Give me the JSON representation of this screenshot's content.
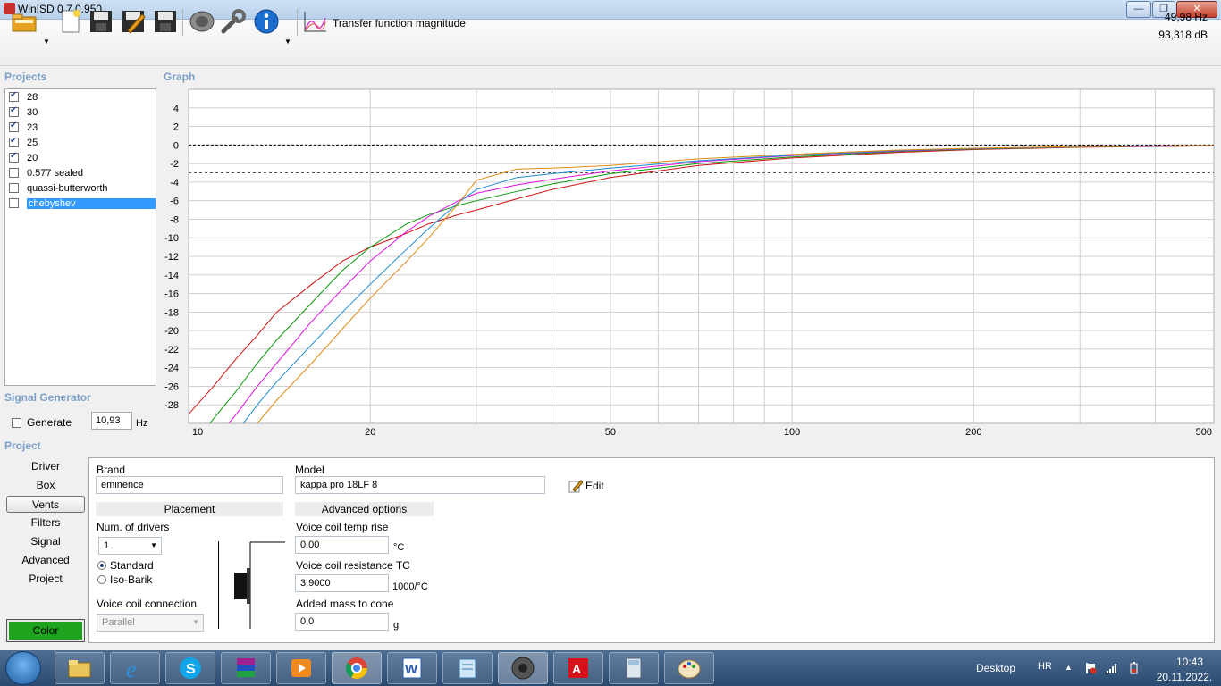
{
  "window": {
    "title": "WinISD 0.7.0.950"
  },
  "toolbar": {
    "mode_label": "Transfer function magnitude",
    "readout_freq": "49,98 Hz",
    "readout_level": "93,318 dB"
  },
  "sections": {
    "projects": "Projects",
    "graph": "Graph",
    "signal_generator": "Signal Generator",
    "project": "Project"
  },
  "projects": [
    {
      "name": "28",
      "checked": true,
      "selected": false
    },
    {
      "name": "30",
      "checked": true,
      "selected": false
    },
    {
      "name": "23",
      "checked": true,
      "selected": false
    },
    {
      "name": "25",
      "checked": true,
      "selected": false
    },
    {
      "name": "20",
      "checked": true,
      "selected": false
    },
    {
      "name": "0.577 sealed",
      "checked": false,
      "selected": false
    },
    {
      "name": "quassi-butterworth",
      "checked": false,
      "selected": false
    },
    {
      "name": "chebyshev",
      "checked": false,
      "selected": true
    }
  ],
  "chart_data": {
    "type": "line",
    "title": "",
    "xlabel": "",
    "ylabel": "",
    "x_scale": "log",
    "xlim": [
      10,
      500
    ],
    "ylim": [
      -30,
      6
    ],
    "x_ticks": [
      "10",
      "20",
      "50",
      "100",
      "200",
      "500"
    ],
    "y_ticks": [
      "4",
      "2",
      "0",
      "-2",
      "-4",
      "-6",
      "-8",
      "-10",
      "-12",
      "-14",
      "-16",
      "-18",
      "-20",
      "-22",
      "-24",
      "-26",
      "-28"
    ],
    "reference_lines": [
      0,
      -3
    ],
    "x": [
      10,
      11,
      12,
      13,
      14,
      16,
      18,
      20,
      23,
      25,
      28,
      30,
      35,
      40,
      50,
      70,
      100,
      150,
      200,
      300,
      500
    ],
    "series": [
      {
        "color": "#d01010",
        "values": [
          -29,
          -26,
          -23,
          -20.5,
          -18,
          -15,
          -12.5,
          -11,
          -9.5,
          -8.5,
          -7.5,
          -7,
          -5.8,
          -4.8,
          -3.5,
          -2.2,
          -1.4,
          -0.8,
          -0.5,
          -0.25,
          -0.1
        ]
      },
      {
        "color": "#0a9a0a",
        "values": [
          -33,
          -29.5,
          -26.5,
          -23.5,
          -21,
          -17,
          -13.5,
          -11,
          -8.5,
          -7.5,
          -6.5,
          -6,
          -5,
          -4.2,
          -3.1,
          -2,
          -1.3,
          -0.7,
          -0.45,
          -0.22,
          -0.08
        ]
      },
      {
        "color": "#e010e0",
        "values": [
          -35,
          -32,
          -29,
          -26,
          -23.5,
          -19,
          -15.5,
          -12.5,
          -9.3,
          -7.7,
          -6,
          -5.2,
          -4.3,
          -3.7,
          -2.8,
          -1.8,
          -1.15,
          -0.65,
          -0.4,
          -0.2,
          -0.08
        ]
      },
      {
        "color": "#1a8ad0",
        "values": [
          -38,
          -34.5,
          -31,
          -28,
          -25.5,
          -21.5,
          -18,
          -15,
          -11.2,
          -9,
          -6.2,
          -4.8,
          -3.5,
          -3.1,
          -2.5,
          -1.7,
          -1.1,
          -0.6,
          -0.38,
          -0.18,
          -0.07
        ]
      },
      {
        "color": "#e08a10",
        "values": [
          -40,
          -36.5,
          -33,
          -30,
          -27.5,
          -23.5,
          -19.8,
          -16.5,
          -12.5,
          -10,
          -6.3,
          -3.8,
          -2.6,
          -2.5,
          -2.2,
          -1.5,
          -1.0,
          -0.55,
          -0.35,
          -0.17,
          -0.06
        ]
      }
    ]
  },
  "signal_generator": {
    "generate_label": "Generate",
    "generate_checked": false,
    "frequency": "10,93",
    "unit": "Hz"
  },
  "project_nav": {
    "items": [
      "Driver",
      "Box",
      "Vents",
      "Filters",
      "Signal",
      "Advanced",
      "Project"
    ],
    "active": "Vents",
    "color_label": "Color",
    "color_value": "#1fa31f"
  },
  "driver_panel": {
    "brand_label": "Brand",
    "brand_value": "eminence",
    "model_label": "Model",
    "model_value": "kappa pro 18LF 8",
    "edit_label": "Edit",
    "placement_header": "Placement",
    "num_drivers_label": "Num. of drivers",
    "num_drivers_value": "1",
    "radio_standard": "Standard",
    "radio_isobarik": "Iso-Barik",
    "coil_connection_label": "Voice coil connection",
    "coil_connection_value": "Parallel",
    "advanced_header": "Advanced options",
    "vc_temp_label": "Voice coil temp rise",
    "vc_temp_value": "0,00",
    "vc_temp_unit": "°C",
    "vc_res_label": "Voice coil resistance TC",
    "vc_res_value": "3,9000",
    "vc_res_unit": "1000/°C",
    "added_mass_label": "Added mass to cone",
    "added_mass_value": "0,0",
    "added_mass_unit": "g"
  },
  "taskbar": {
    "desktop_label": "Desktop",
    "lang": "HR",
    "time": "10:43",
    "date": "20.11.2022."
  }
}
